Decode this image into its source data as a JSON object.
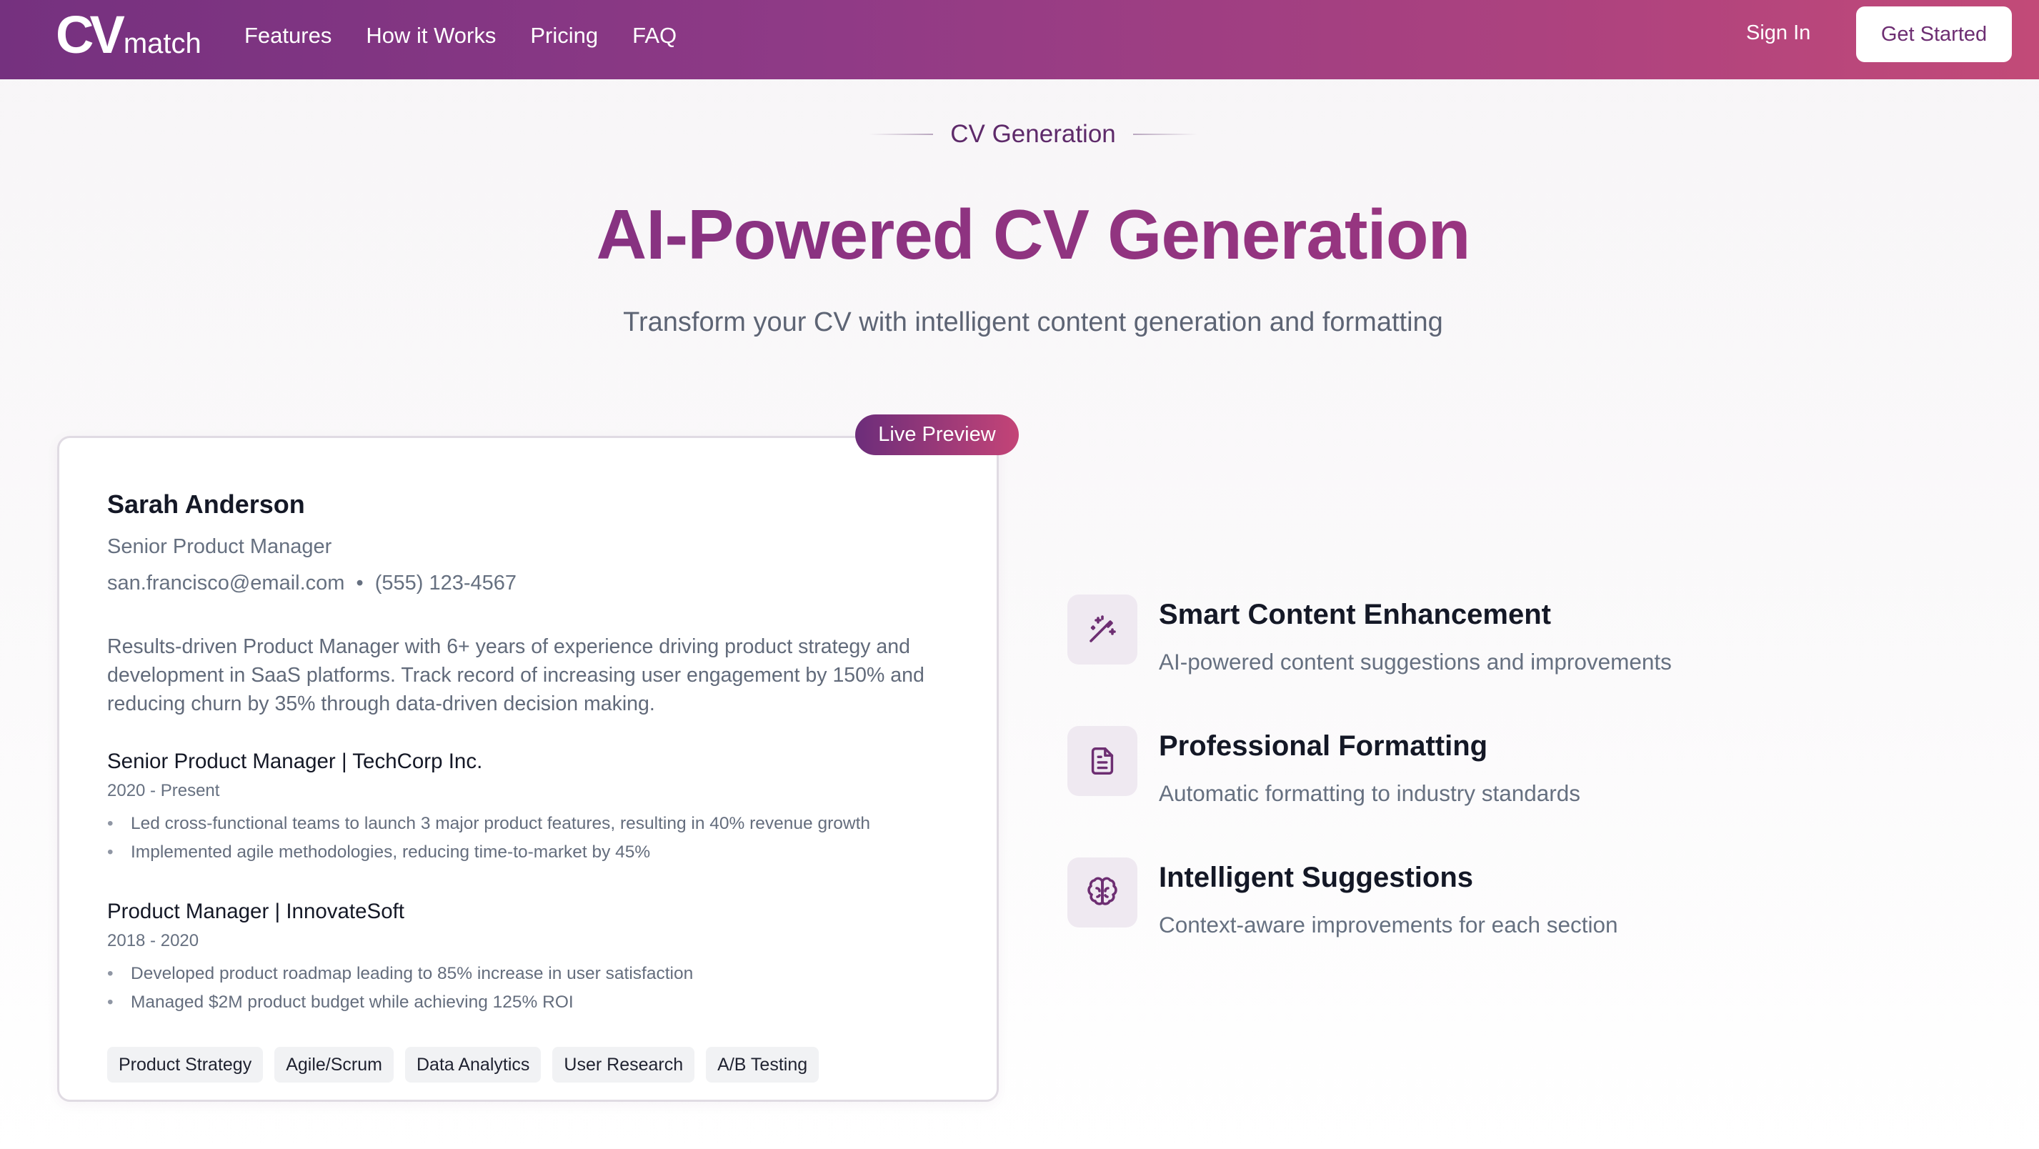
{
  "nav": {
    "logo_mark": "CV",
    "logo_text": "match",
    "links": [
      "Features",
      "How it Works",
      "Pricing",
      "FAQ"
    ],
    "sign_in": "Sign In",
    "get_started": "Get Started"
  },
  "hero": {
    "eyebrow": "CV Generation",
    "title": "AI-Powered CV Generation",
    "subtitle": "Transform your CV with intelligent content generation and formatting"
  },
  "preview": {
    "badge": "Live Preview",
    "name": "Sarah Anderson",
    "role": "Senior Product Manager",
    "email": "san.francisco@email.com",
    "separator": "•",
    "phone": "(555) 123-4567",
    "summary": "Results-driven Product Manager with 6+ years of experience driving product strategy and development in SaaS platforms. Track record of increasing user engagement by 150% and reducing churn by 35% through data-driven decision making.",
    "jobs": [
      {
        "title": "Senior Product Manager | TechCorp Inc.",
        "dates": "2020 - Present",
        "bullets": [
          "Led cross-functional teams to launch 3 major product features, resulting in 40% revenue growth",
          "Implemented agile methodologies, reducing time-to-market by 45%"
        ]
      },
      {
        "title": "Product Manager | InnovateSoft",
        "dates": "2018 - 2020",
        "bullets": [
          "Developed product roadmap leading to 85% increase in user satisfaction",
          "Managed $2M product budget while achieving 125% ROI"
        ]
      }
    ],
    "skills": [
      "Product Strategy",
      "Agile/Scrum",
      "Data Analytics",
      "User Research",
      "A/B Testing"
    ]
  },
  "features": [
    {
      "icon": "magic-wand-icon",
      "title": "Smart Content Enhancement",
      "desc": "AI-powered content suggestions and improvements"
    },
    {
      "icon": "document-icon",
      "title": "Professional Formatting",
      "desc": "Automatic formatting to industry standards"
    },
    {
      "icon": "brain-icon",
      "title": "Intelligent Suggestions",
      "desc": "Context-aware improvements for each section"
    }
  ],
  "colors": {
    "brand_start": "#75317f",
    "brand_end": "#c24a78",
    "icon_stroke": "#6d2e72",
    "icon_bg": "#efe9f1"
  }
}
